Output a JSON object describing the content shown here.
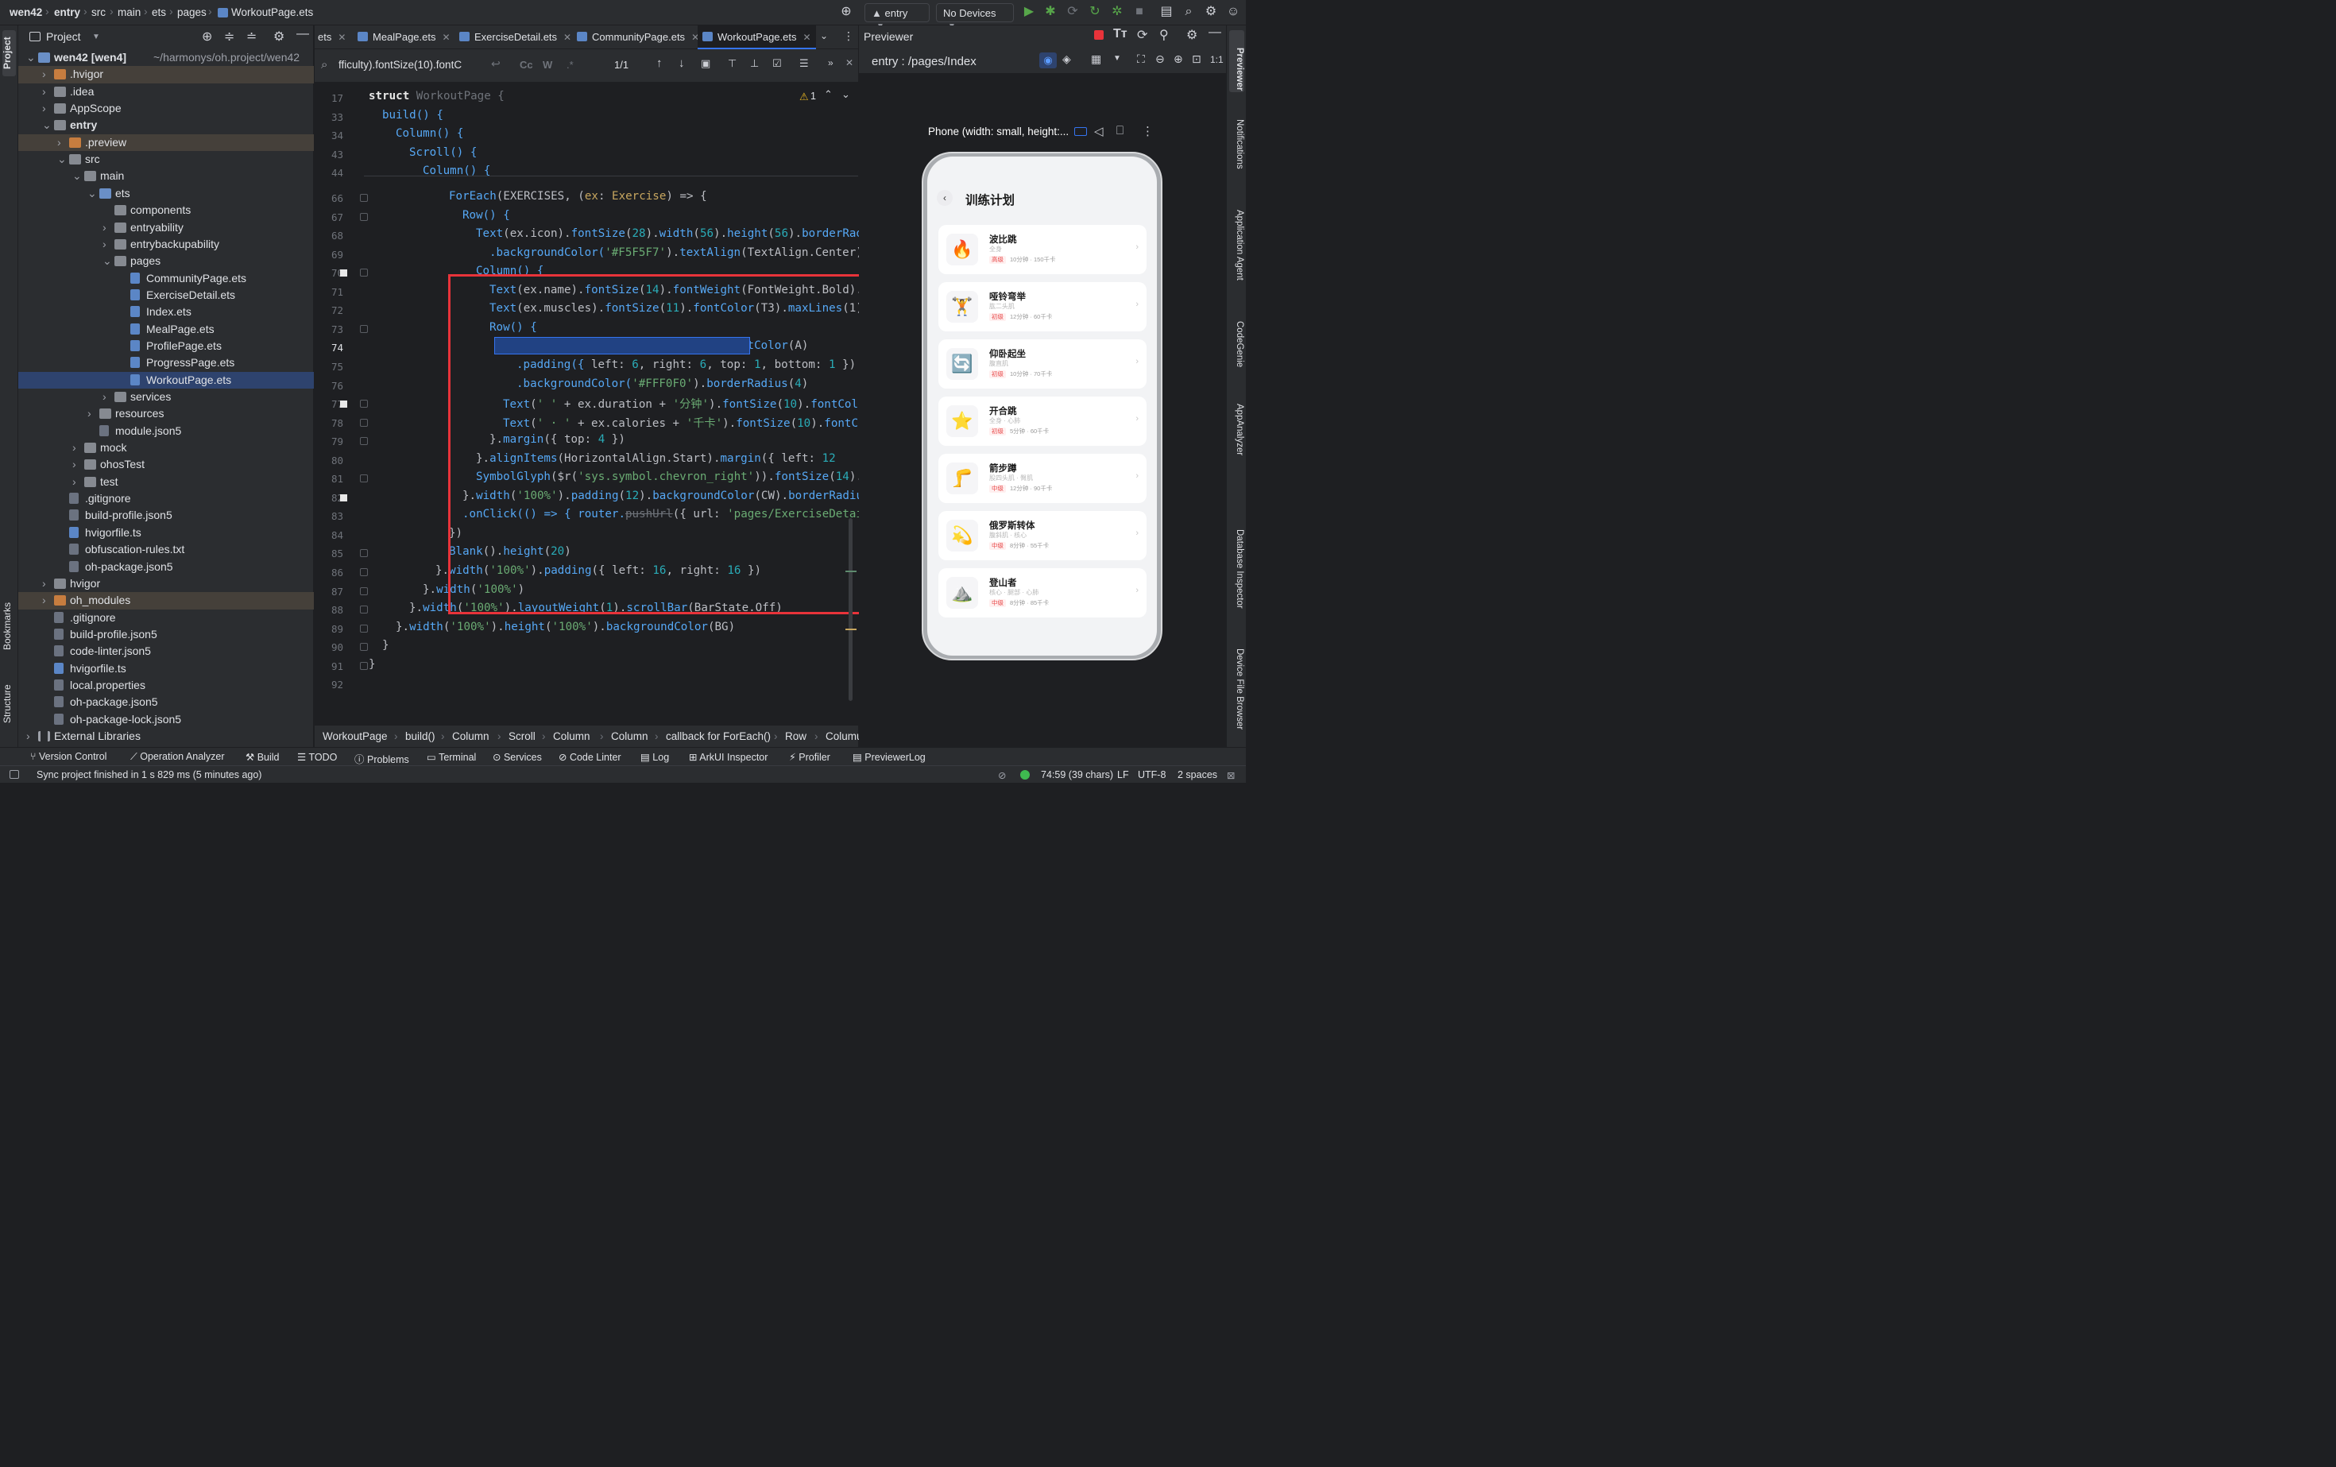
{
  "titlebar": {
    "crumbs": [
      "wen42",
      "entry",
      "src",
      "main",
      "ets",
      "pages",
      "WorkoutPage.ets"
    ],
    "run_config": "entry",
    "device": "No Devices"
  },
  "leftstrip": {
    "project_label": "Project",
    "bookmarks_label": "Bookmarks",
    "structure_label": "Structure"
  },
  "project": {
    "title": "Project",
    "tree": [
      {
        "label": "wen42 [wen4]",
        "extra": "~/harmonys/oh.project/wen42"
      },
      {
        "label": ".hvigor"
      },
      {
        "label": ".idea"
      },
      {
        "label": "AppScope"
      },
      {
        "label": "entry"
      },
      {
        "label": ".preview"
      },
      {
        "label": "src"
      },
      {
        "label": "main"
      },
      {
        "label": "ets"
      },
      {
        "label": "components"
      },
      {
        "label": "entryability"
      },
      {
        "label": "entrybackupability"
      },
      {
        "label": "pages"
      },
      {
        "label": "CommunityPage.ets"
      },
      {
        "label": "ExerciseDetail.ets"
      },
      {
        "label": "Index.ets"
      },
      {
        "label": "MealPage.ets"
      },
      {
        "label": "ProfilePage.ets"
      },
      {
        "label": "ProgressPage.ets"
      },
      {
        "label": "WorkoutPage.ets"
      },
      {
        "label": "services"
      },
      {
        "label": "resources"
      },
      {
        "label": "module.json5"
      },
      {
        "label": "mock"
      },
      {
        "label": "ohosTest"
      },
      {
        "label": "test"
      },
      {
        "label": ".gitignore"
      },
      {
        "label": "build-profile.json5"
      },
      {
        "label": "hvigorfile.ts"
      },
      {
        "label": "obfuscation-rules.txt"
      },
      {
        "label": "oh-package.json5"
      },
      {
        "label": "hvigor"
      },
      {
        "label": "oh_modules"
      },
      {
        "label": ".gitignore"
      },
      {
        "label": "build-profile.json5"
      },
      {
        "label": "code-linter.json5"
      },
      {
        "label": "hvigorfile.ts"
      },
      {
        "label": "local.properties"
      },
      {
        "label": "oh-package.json5"
      },
      {
        "label": "oh-package-lock.json5"
      },
      {
        "label": "External Libraries"
      }
    ]
  },
  "editor": {
    "tabs": [
      "ets",
      "MealPage.ets",
      "ExerciseDetail.ets",
      "CommunityPage.ets",
      "WorkoutPage.ets"
    ],
    "find_query": "fficulty).fontSize(10).fontC",
    "find_count": "1/1",
    "warning_count": "1",
    "line_numbers": [
      "17",
      "33",
      "34",
      "43",
      "44",
      "66",
      "67",
      "68",
      "69",
      "70",
      "71",
      "72",
      "73",
      "74",
      "75",
      "76",
      "77",
      "78",
      "79",
      "80",
      "81",
      "82",
      "83",
      "84",
      "85",
      "86",
      "87",
      "88",
      "89",
      "90",
      "91",
      "92"
    ],
    "code_texts": {
      "l17_kw": "struct ",
      "l17_name": "WorkoutPage {",
      "l33": "build() {",
      "l34": "Column() {",
      "l43": "Scroll() {",
      "l44": "Column() {",
      "l66a": "ForEach",
      "l66b": "(EXERCISES, (",
      "l66c": "ex",
      "l66d": ": ",
      "l66e": "Exercise",
      "l66f": ") => {",
      "l67": "Row() {",
      "l68a": "Text",
      "l68b": "(ex.icon).",
      "l68c": "fontSize",
      "l68d": "(",
      "l68e": "28",
      "l68f": ").",
      "l68g": "width",
      "l68h": "(",
      "l68i": "56",
      "l68j": ").",
      "l68k": "height",
      "l68l": "(",
      "l68m": "56",
      "l68n": ").",
      "l68o": "borderRadi",
      "l69a": ".backgroundColor(",
      "l69b": "'#F5F5F7'",
      "l69c": ").",
      "l69d": "textAlign",
      "l69e": "(TextAlign.Center)",
      "l70": "Column() {",
      "l71a": "Text",
      "l71b": "(ex.name).",
      "l71c": "fontSize",
      "l71d": "(",
      "l71e": "14",
      "l71f": ").",
      "l71g": "fontWeight",
      "l71h": "(FontWeight.Bold).f",
      "l72a": "Text",
      "l72b": "(ex.muscles).",
      "l72c": "fontSize",
      "l72d": "(",
      "l72e": "11",
      "l72f": ").",
      "l72g": "fontColor",
      "l72h": "(T3).",
      "l72i": "maxLines",
      "l72j": "(1).",
      "l73": "Row() {",
      "l74a": "Text",
      "l74b": "(ex.difficulty).",
      "l74c": "fontSize",
      "l74d": "(",
      "l74e": "10",
      "l74f": ").",
      "l74g": "fontColor",
      "l74h": "(A)",
      "l75a": ".padding({ ",
      "l75b": "left: ",
      "l75c": "6",
      "l75d": ", right: ",
      "l75e": "6",
      "l75f": ", top: ",
      "l75g": "1",
      "l75h": ", bottom: ",
      "l75i": "1",
      "l75j": " })",
      "l76a": ".backgroundColor(",
      "l76b": "'#FFF0F0'",
      "l76c": ").",
      "l76d": "borderRadius",
      "l76e": "(",
      "l76f": "4",
      ")": ")",
      "l77a": "Text",
      "l77b": "(",
      "l77c": "' '",
      "l77d": " + ex.duration + ",
      "l77e": "'分钟'",
      "l77f": ").",
      "l77g": "fontSize",
      "l77h": "(",
      "l77i": "10",
      "l77j": ").",
      "l77k": "fontColor",
      "l78a": "Text",
      "l78b": "(",
      "l78c": "' · '",
      "l78d": " + ex.calories + ",
      "l78e": "'千卡'",
      "l78f": ").",
      "l78g": "fontSize",
      "l78h": "(",
      "l78i": "10",
      "l78j": ").",
      "l78k": "fontCol",
      "l79a": "}.",
      "l79b": "margin",
      "l79c": "({ top: ",
      "l79d": "4",
      " })": " })",
      "l80a": "}.",
      "l80b": "alignItems",
      "l80c": "(HorizontalAlign.Start).",
      "l80d": "margin",
      "l80e": "({ left: ",
      "l80f": "12",
      " }).l": " }).l",
      "l81a": "SymbolGlyph",
      "l81b": "($r(",
      "l81c": "'sys.symbol.chevron_right'",
      "l81d": ")).",
      "l81e": "fontSize",
      "l81f": "(",
      "l81g": "14",
      "l81h": ").f",
      "l82a": "}.",
      "l82b": "width",
      "l82c": "(",
      "l82d": "'100%'",
      "l82e": ").",
      "l82f": "padding",
      "l82g": "(",
      "l82h": "12",
      "l82i": ").",
      "l82j": "backgroundColor",
      "l82k": "(CW).",
      "l82l": "borderRadius",
      "l83a": ".onClick(() => { router.",
      "l83b": "pushUrl",
      "l83c": "({ url: ",
      "l83d": "'pages/ExerciseDetail",
      "l84": "})",
      "l85a": "Blank",
      "l85b": "().",
      "l85c": "height",
      "l85d": "(",
      "l85e": "20",
      "l85f": ")",
      "l86a": "}.",
      "l86b": "width",
      "l86c": "(",
      "l86d": "'100%'",
      "l86e": ").",
      "l86f": "padding",
      "l86g": "({ left: ",
      "l86h": "16",
      "l86i": ", right: ",
      "l86j": "16",
      "l87a": "}.",
      "l87b": "width",
      "l87c": "(",
      "l87d": "'100%'",
      "l87e": ")",
      "l88a": "}.",
      "l88b": "width",
      "l88c": "(",
      "l88d": "'100%'",
      "l88e": ").",
      "l88f": "layoutWeight",
      "l88g": "(",
      "l88h": "1",
      "l88i": ").",
      "l88j": "scrollBar",
      "l88k": "(BarState.Off)",
      "l89a": "}.",
      "l89b": "width",
      "l89c": "(",
      "l89d": "'100%'",
      "l89e": ").",
      "l89f": "height",
      "l89g": "(",
      "l89h": "'100%'",
      "l89i": ").",
      "l89j": "backgroundColor",
      "l89k": "(BG)",
      "l90": "}",
      "l91": "}"
    },
    "breadcrumbs": [
      "WorkoutPage",
      "build()",
      "Column",
      "Scroll",
      "Column",
      "Column",
      "callback for ForEach()",
      "Row",
      "Columu"
    ]
  },
  "previewer": {
    "title": "Previewer",
    "route": "entry : /pages/Index",
    "device_label": "Phone (width: small, height:...",
    "app_title": "训练计划",
    "exercises": [
      {
        "icon": "🔥",
        "name": "波比跳",
        "muscles": "全身",
        "difficulty": "高级",
        "meta": "10分钟 · 150千卡"
      },
      {
        "icon": "🏋️",
        "name": "哑铃弯举",
        "muscles": "肱二头肌",
        "difficulty": "初级",
        "meta": "12分钟 · 60千卡"
      },
      {
        "icon": "🔄",
        "name": "仰卧起坐",
        "muscles": "腹直肌",
        "difficulty": "初级",
        "meta": "10分钟 · 70千卡"
      },
      {
        "icon": "⭐",
        "name": "开合跳",
        "muscles": "全身 · 心肺",
        "difficulty": "初级",
        "meta": "5分钟 · 60千卡"
      },
      {
        "icon": "🦵",
        "name": "箭步蹲",
        "muscles": "股四头肌 · 臀肌",
        "difficulty": "中级",
        "meta": "12分钟 · 90千卡"
      },
      {
        "icon": "💫",
        "name": "俄罗斯转体",
        "muscles": "腹斜肌 · 核心",
        "difficulty": "中级",
        "meta": "8分钟 · 55千卡"
      },
      {
        "icon": "⛰️",
        "name": "登山者",
        "muscles": "核心 · 腿部 · 心肺",
        "difficulty": "中级",
        "meta": "8分钟 · 85千卡"
      }
    ]
  },
  "rightstrip": [
    "Previewer",
    "Notifications",
    "Application Agent",
    "CodeGenie",
    "AppAnalyzer",
    "Database Inspector",
    "Device File Browser"
  ],
  "toolwindows": [
    "Version Control",
    "Operation Analyzer",
    "Build",
    "TODO",
    "Problems",
    "Terminal",
    "Services",
    "Code Linter",
    "Log",
    "ArkUI Inspector",
    "Profiler",
    "PreviewerLog"
  ],
  "status": {
    "message": "Sync project finished in 1 s 829 ms (5 minutes ago)",
    "position": "74:59 (39 chars)",
    "line_sep": "LF",
    "encoding": "UTF-8",
    "indent": "2 spaces"
  },
  "colors": {
    "accent": "#3574f0",
    "highlight_box": "#e8333a",
    "difficulty_red": "#e84a4a"
  }
}
